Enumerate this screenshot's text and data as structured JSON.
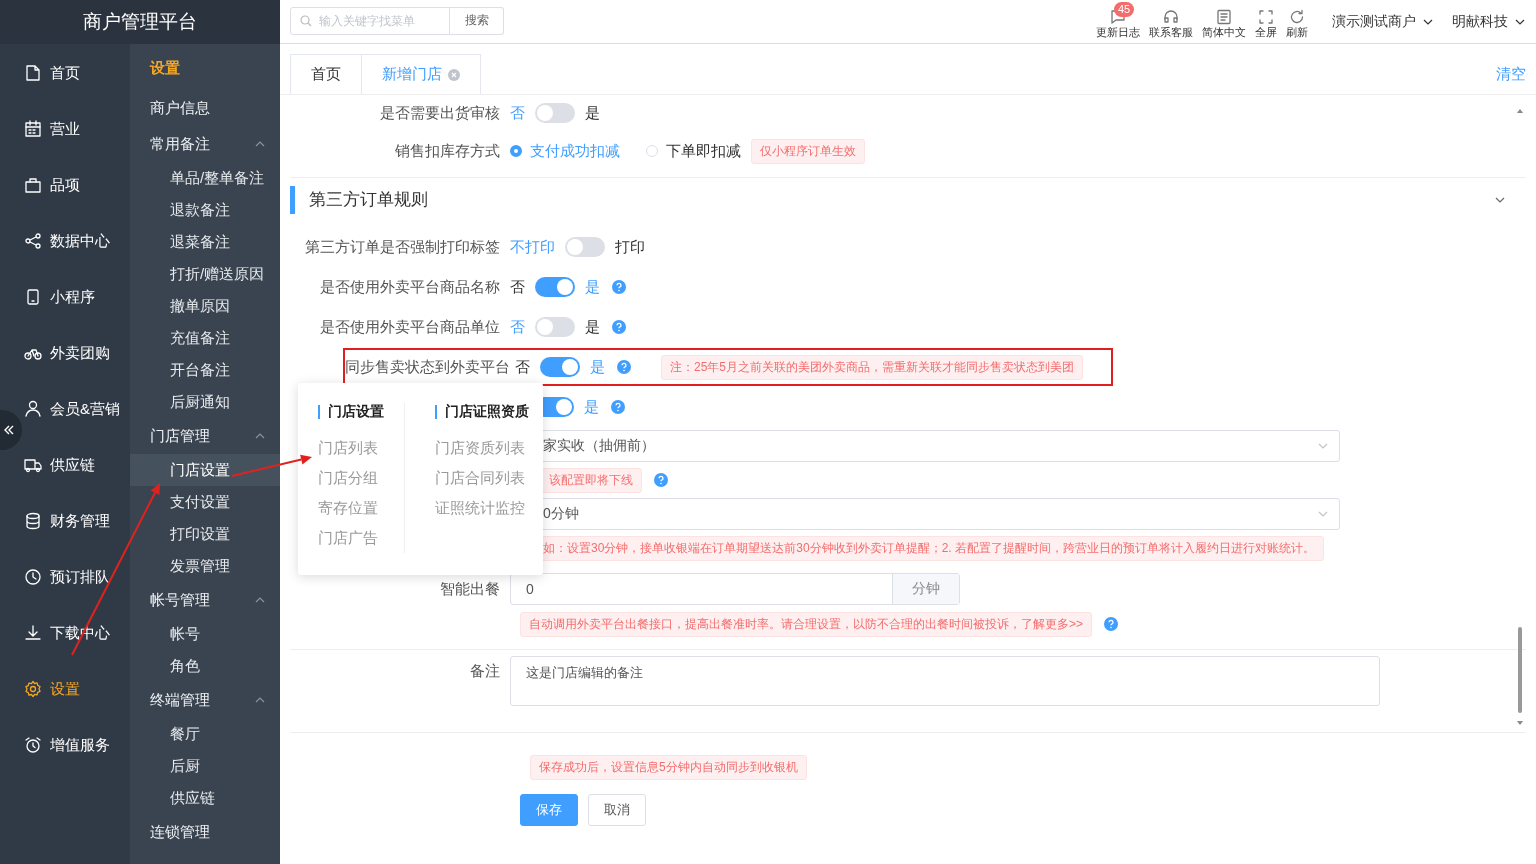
{
  "brand": {
    "title": "商户管理平台"
  },
  "sidebar": {
    "items": [
      {
        "label": "首页",
        "selected": false
      },
      {
        "label": "营业",
        "selected": false
      },
      {
        "label": "品项",
        "selected": false
      },
      {
        "label": "数据中心",
        "selected": false
      },
      {
        "label": "小程序",
        "selected": false
      },
      {
        "label": "外卖团购",
        "selected": false
      },
      {
        "label": "会员&营销",
        "selected": false
      },
      {
        "label": "供应链",
        "selected": false
      },
      {
        "label": "财务管理",
        "selected": false
      },
      {
        "label": "预订排队",
        "selected": false
      },
      {
        "label": "下载中心",
        "selected": false
      },
      {
        "label": "设置",
        "selected": true
      },
      {
        "label": "增值服务",
        "selected": false
      }
    ]
  },
  "subnav": {
    "title": "设置",
    "items": [
      {
        "label": "商户信息",
        "selected": false
      },
      {
        "label": "常用备注",
        "expanded": true,
        "children": [
          {
            "label": "单品/整单备注",
            "selected": false
          },
          {
            "label": "退款备注",
            "selected": false
          },
          {
            "label": "退菜备注",
            "selected": false
          },
          {
            "label": "打折/赠送原因",
            "selected": false
          },
          {
            "label": "撤单原因",
            "selected": false
          },
          {
            "label": "充值备注",
            "selected": false
          },
          {
            "label": "开台备注",
            "selected": false
          },
          {
            "label": "后厨通知",
            "selected": false
          }
        ]
      },
      {
        "label": "门店管理",
        "expanded": true,
        "children": [
          {
            "label": "门店设置",
            "selected": true
          },
          {
            "label": "支付设置",
            "selected": false
          },
          {
            "label": "打印设置",
            "selected": false
          },
          {
            "label": "发票管理",
            "selected": false
          }
        ]
      },
      {
        "label": "帐号管理",
        "expanded": true,
        "children": [
          {
            "label": "帐号",
            "selected": false
          },
          {
            "label": "角色",
            "selected": false
          }
        ]
      },
      {
        "label": "终端管理",
        "expanded": true,
        "children": [
          {
            "label": "餐厅",
            "selected": false
          },
          {
            "label": "后厨",
            "selected": false
          },
          {
            "label": "供应链",
            "selected": false
          }
        ]
      },
      {
        "label": "连锁管理",
        "selected": false
      }
    ]
  },
  "topbar": {
    "search": {
      "placeholder": "输入关键字找菜单",
      "button": "搜索"
    },
    "tools": [
      {
        "label": "更新日志",
        "badge": "45"
      },
      {
        "label": "联系客服"
      },
      {
        "label": "简体中文"
      },
      {
        "label": "全屏"
      },
      {
        "label": "刷新"
      }
    ],
    "accounts": [
      "演示测试商户",
      "明献科技"
    ]
  },
  "tabs": {
    "items": [
      {
        "label": "首页",
        "selected": false
      },
      {
        "label": "新增门店",
        "selected": true,
        "closable": true
      }
    ],
    "clear": "清空"
  },
  "form": {
    "rows": [
      {
        "kind": "toggle",
        "label": "是否需要出货审核",
        "off_label": "否",
        "on_label": "是",
        "on": false
      },
      {
        "kind": "radio",
        "label": "销售扣库存方式",
        "options": [
          {
            "label": "支付成功扣减",
            "selected": true
          },
          {
            "label": "下单即扣减",
            "selected": false
          }
        ],
        "tag": "仅小程序订单生效"
      },
      {
        "kind": "section",
        "title": "第三方订单规则",
        "expanded": true
      },
      {
        "kind": "toggle",
        "label": "第三方订单是否强制打印标签",
        "off_label": "不打印",
        "on_label": "打印",
        "on": false
      },
      {
        "kind": "toggle",
        "label": "是否使用外卖平台商品名称",
        "off_label": "否",
        "on_label": "是",
        "on": true,
        "help": true
      },
      {
        "kind": "toggle",
        "label": "是否使用外卖平台商品单位",
        "off_label": "否",
        "on_label": "是",
        "on": false,
        "help": true
      },
      {
        "kind": "toggle",
        "label": "同步售卖状态到外卖平台",
        "off_label": "否",
        "on_label": "是",
        "on": true,
        "help": true,
        "note": "注：25年5月之前关联的美团外卖商品，需重新关联才能同步售卖状态到美团",
        "highlighted": true
      },
      {
        "kind": "toggle",
        "on_label": "是",
        "on": true,
        "help": true
      },
      {
        "kind": "select",
        "value": "家实收（抽佣前）",
        "tag": "该配置即将下线",
        "help": true
      },
      {
        "kind": "select",
        "value": "0分钟",
        "hint": "如：设置30分钟，接单收银端在订单期望送达前30分钟收到外卖订单提醒；2. 若配置了提醒时间，跨营业日的预订单将计入履约日进行对账统计。"
      },
      {
        "kind": "input_addon",
        "label": "智能出餐",
        "value": "0",
        "addon": "分钟",
        "hint": "自动调用外卖平台出餐接口，提高出餐准时率。请合理设置，以防不合理的出餐时间被投诉，了解更多>>",
        "help": true
      },
      {
        "kind": "textarea",
        "label": "备注",
        "value": "这是门店编辑的备注"
      },
      {
        "kind": "actions",
        "notice": "保存成功后，设置信息5分钟内自动同步到收银机",
        "buttons": [
          {
            "label": "保存",
            "primary": true
          },
          {
            "label": "取消",
            "primary": false
          }
        ]
      }
    ]
  },
  "popover": {
    "columns": [
      {
        "title": "门店设置",
        "items": [
          "门店列表",
          "门店分组",
          "寄存位置",
          "门店广告"
        ]
      },
      {
        "title": "门店证照资质",
        "items": [
          "门店资质列表",
          "门店合同列表",
          "证照统计监控"
        ]
      }
    ]
  }
}
